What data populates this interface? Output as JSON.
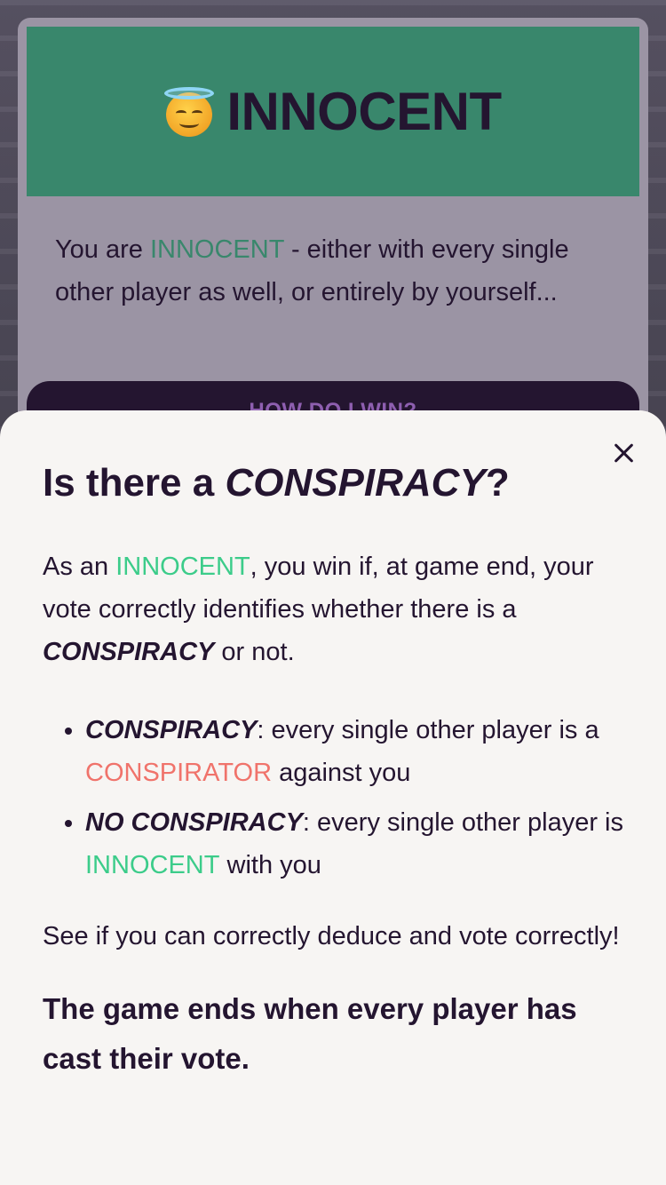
{
  "card": {
    "role_title": "INNOCENT",
    "desc_pre": "You are ",
    "desc_role": "INNOCENT",
    "desc_post": " - either with every single other player as well, or entirely by yourself...",
    "how_button": "HOW DO I WIN?"
  },
  "sheet": {
    "title_pre": "Is there a ",
    "title_em": "CONSPIRACY",
    "title_post": "?",
    "intro_pre": "As an ",
    "intro_role": "INNOCENT",
    "intro_mid": ", you win if, at game end, your vote correctly identifies whether there is a ",
    "intro_em": "CONSPIRACY",
    "intro_post": " or not.",
    "bullets": [
      {
        "term": "CONSPIRACY",
        "text_pre": ": every single other player is a ",
        "role": "CONSPIRATOR",
        "text_post": " against you"
      },
      {
        "term": "NO CONSPIRACY",
        "text_pre": ": every single other player is ",
        "role": "INNOCENT",
        "text_post": " with you"
      }
    ],
    "deduce": "See if you can correctly deduce and vote correctly!",
    "final": "The game ends when every player has cast their vote."
  },
  "colors": {
    "banner": "#39876c",
    "dark": "#241530",
    "innocent": "#3ccc8a",
    "conspirator": "#f0736b"
  },
  "icons": {
    "role_icon": "smiling-face-with-halo-icon",
    "close": "close-icon"
  }
}
